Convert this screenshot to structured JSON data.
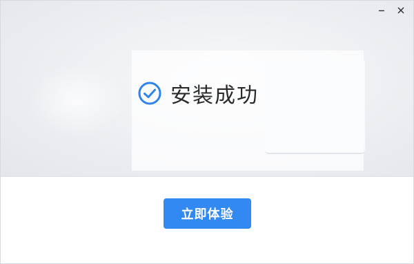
{
  "window": {
    "minimize_icon": "minimize-icon",
    "close_icon": "close-icon"
  },
  "status": {
    "icon": "check-circle-icon",
    "text": "安装成功"
  },
  "action": {
    "launch_label": "立即体验"
  },
  "colors": {
    "accent": "#3389f2",
    "check_icon": "#2f83ea",
    "text": "#2a2a2a"
  }
}
